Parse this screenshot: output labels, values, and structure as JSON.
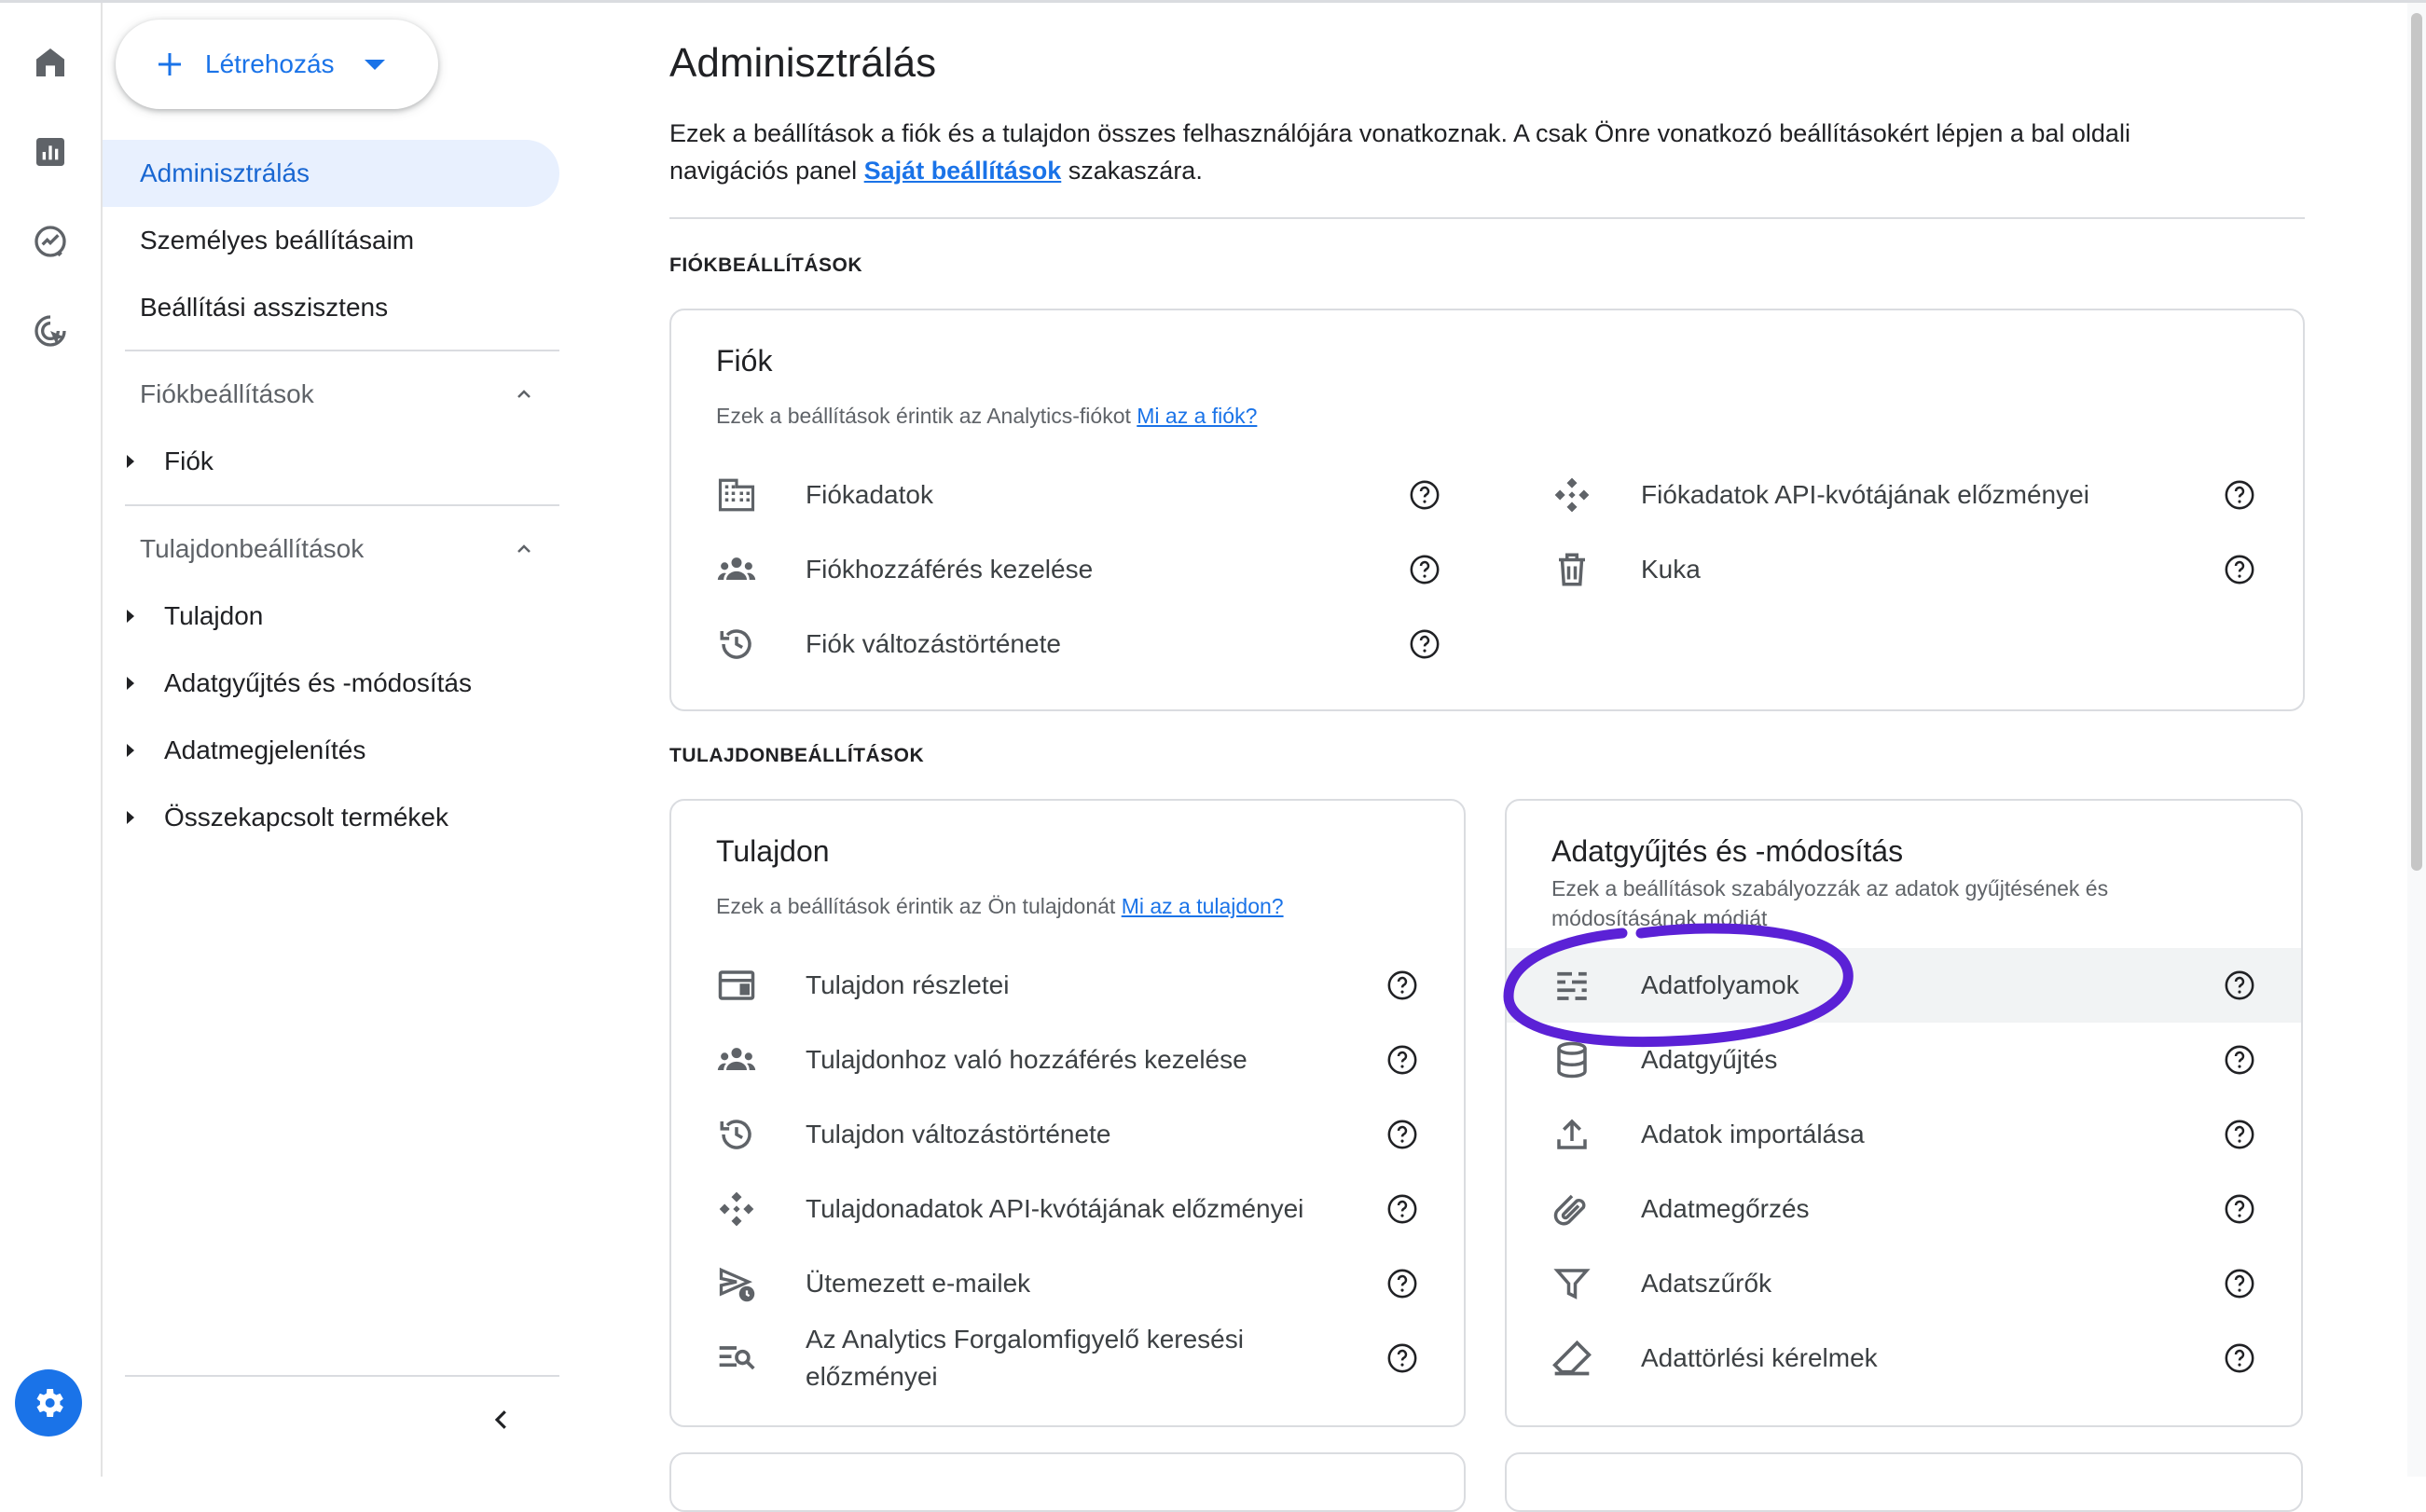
{
  "sidebar": {
    "create_label": "Létrehozás",
    "nav": [
      "Adminisztrálás",
      "Személyes beállításaim",
      "Beállítási asszisztens"
    ],
    "account_section": "Fiókbeállítások",
    "account_items": [
      "Fiók"
    ],
    "property_section": "Tulajdonbeállítások",
    "property_items": [
      "Tulajdon",
      "Adatgyűjtés és -módosítás",
      "Adatmegjelenítés",
      "Összekapcsolt termékek"
    ]
  },
  "rail": {
    "icons": [
      "home-icon",
      "reports-icon",
      "explore-icon",
      "advertising-icon",
      "settings-icon"
    ]
  },
  "main": {
    "title": "Adminisztrálás",
    "desc_part1": "Ezek a beállítások a fiók és a tulajdon összes felhasználójára vonatkoznak. A csak Önre vonatkozó beállításokért lépjen a bal oldali navigációs panel ",
    "desc_link": "Saját beállítások",
    "desc_part2": " szakaszára.",
    "account_caption": "FIÓKBEÁLLÍTÁSOK",
    "property_caption": "TULAJDONBEÁLLÍTÁSOK",
    "account_card": {
      "title": "Fiók",
      "subtitle": "Ezek a beállítások érintik az Analytics-fiókot ",
      "subtitle_link": "Mi az a fiók?",
      "items_left": [
        "Fiókadatok",
        "Fiókhozzáférés kezelése",
        "Fiók változástörténete"
      ],
      "items_right": [
        "Fiókadatok API-kvótájának előzményei",
        "Kuka"
      ]
    },
    "property_card": {
      "title": "Tulajdon",
      "subtitle": "Ezek a beállítások érintik az Ön tulajdonát ",
      "subtitle_link": "Mi az a tulajdon?",
      "items": [
        "Tulajdon részletei",
        "Tulajdonhoz való hozzáférés kezelése",
        "Tulajdon változástörténete",
        "Tulajdonadatok API-kvótájának előzményei",
        "Ütemezett e-mailek"
      ],
      "item_last_line1": "Az Analytics Forgalomfigyelő keresési",
      "item_last_line2": "előzményei"
    },
    "data_card": {
      "title": "Adatgyűjtés és -módosítás",
      "subtitle_line1": "Ezek a beállítások szabályozzák az adatok gyűjtésének és",
      "subtitle_line2": "módosításának módját",
      "items": [
        "Adatfolyamok",
        "Adatgyűjtés",
        "Adatok importálása",
        "Adatmegőrzés",
        "Adatszűrők",
        "Adattörlési kérelmek"
      ]
    }
  },
  "colors": {
    "accent": "#1a73e8",
    "active_bg": "#e8f0fe",
    "annotation": "#5b21d6"
  }
}
